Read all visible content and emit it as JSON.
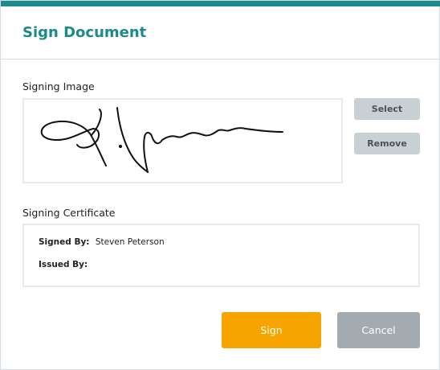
{
  "dialog": {
    "title": "Sign Document",
    "accent_color": "#1f8a8c"
  },
  "signing_image": {
    "label": "Signing Image",
    "select_label": "Select",
    "remove_label": "Remove"
  },
  "signing_certificate": {
    "label": "Signing Certificate",
    "signed_by_label": "Signed By:",
    "signed_by_value": "Steven Peterson",
    "issued_by_label": "Issued By:",
    "issued_by_value": ""
  },
  "footer": {
    "sign_label": "Sign",
    "cancel_label": "Cancel",
    "sign_color": "#f7a300",
    "cancel_color": "#a3abb0"
  }
}
